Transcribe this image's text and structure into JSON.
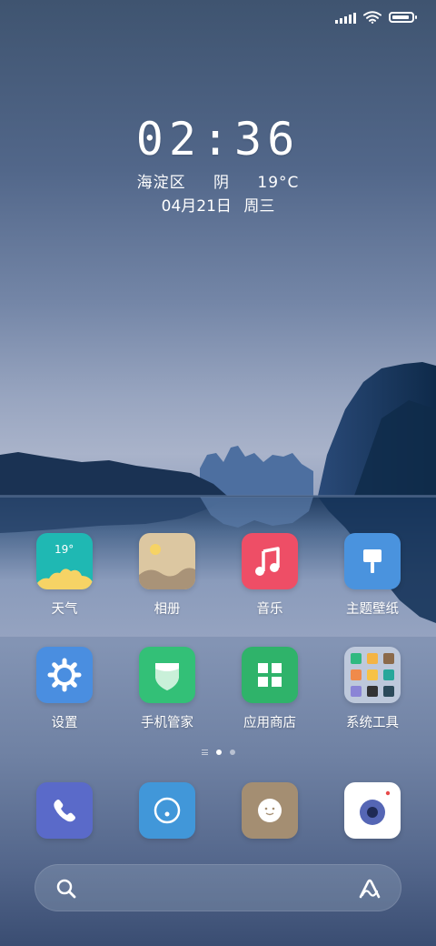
{
  "status_bar": {
    "signal_icon": "signal-icon",
    "wifi_icon": "wifi-icon",
    "battery_icon": "battery-icon",
    "battery_level": 0.9
  },
  "clock": {
    "time": "02:36"
  },
  "weather": {
    "district": "海淀区",
    "condition": "阴",
    "temperature": "19°C"
  },
  "date": {
    "day": "04月21日",
    "weekday": "周三"
  },
  "apps": [
    {
      "label": "天气",
      "icon": "weather-icon",
      "badge": "19°",
      "color": "#1fb8b3"
    },
    {
      "label": "相册",
      "icon": "gallery-icon",
      "color": "#dcc7a1"
    },
    {
      "label": "音乐",
      "icon": "music-icon",
      "color": "#ee4e66"
    },
    {
      "label": "主题壁纸",
      "icon": "theme-icon",
      "color": "#4a93de"
    },
    {
      "label": "设置",
      "icon": "settings-gear-icon",
      "color": "#4a8ee0"
    },
    {
      "label": "手机管家",
      "icon": "security-shield-icon",
      "color": "#33c077"
    },
    {
      "label": "应用商店",
      "icon": "app-store-grid-icon",
      "color": "#2fb36a"
    },
    {
      "label": "系统工具",
      "icon": "folder-icon",
      "color": "#c9d2e3"
    }
  ],
  "page_indicator": {
    "pages": 3,
    "current": 2
  },
  "dock": [
    {
      "icon": "phone-icon",
      "color": "#5a6ac9"
    },
    {
      "icon": "browser-icon",
      "color": "#4197d9"
    },
    {
      "icon": "messages-icon",
      "color": "#a48e72"
    },
    {
      "icon": "camera-icon",
      "color": "#ffffff"
    }
  ],
  "search": {
    "placeholder": "",
    "search_icon": "search-icon",
    "assistant_icon": "assistant-icon"
  }
}
